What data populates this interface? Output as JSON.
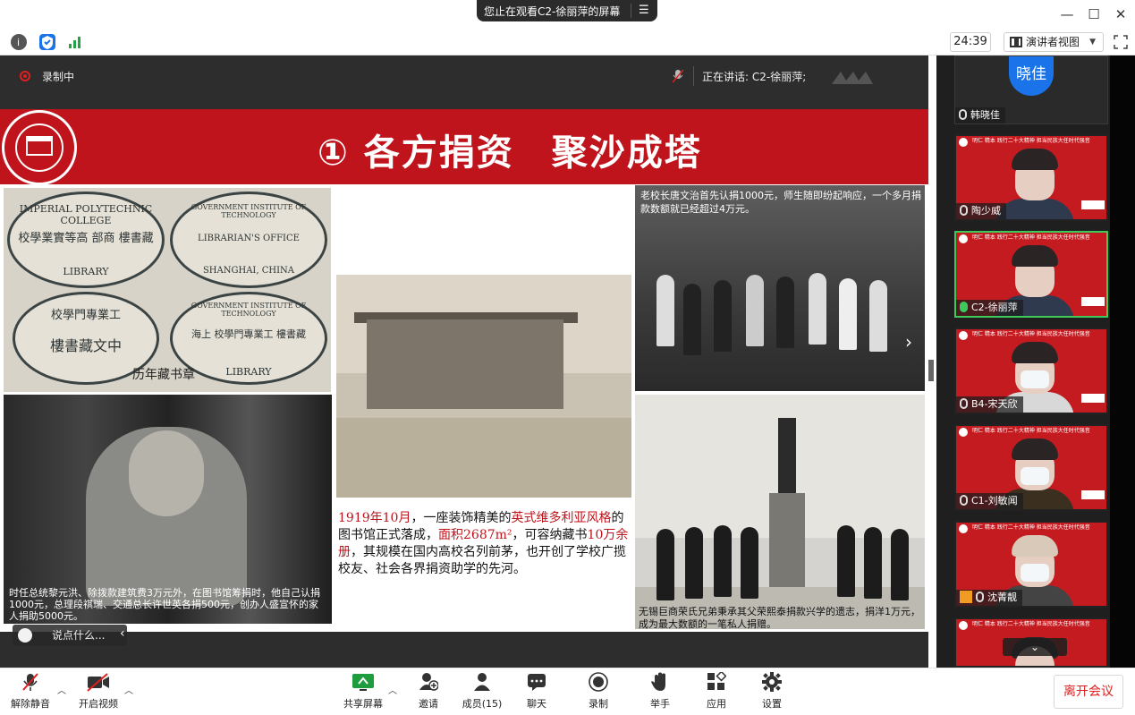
{
  "title_bar": {
    "viewing_label": "您止在观看C2-徐丽萍的屏幕",
    "menu_icon": "menu-icon",
    "window_controls": [
      "minimize-icon",
      "maximize-icon",
      "close-icon"
    ]
  },
  "top_toolbar": {
    "icons": [
      "info-icon",
      "shield-icon",
      "signal-bars-icon"
    ],
    "timer": "24:39",
    "presenter_view": "演讲者视图",
    "fullscreen_icon": "fullscreen-icon"
  },
  "share_header": {
    "recording_label": "录制中",
    "speaking_label": "正在讲话: C2-徐丽萍;"
  },
  "slide": {
    "title": "① 各方捐资　聚沙成塔",
    "stamps_caption": "历年藏书章",
    "stamp_texts": [
      "IMPERIAL POLYTECHNIC COLLEGE",
      "校學業實等高 部商 樓書藏",
      "LIBRARY",
      "GOVERNMENT INSTITUTE OF TECHNOLOGY",
      "LIBRARIAN'S OFFICE",
      "SHANGHAI, CHINA",
      "校學門專業工",
      "樓書藏文中",
      "海上 校學門專業工 樓書藏",
      "LIBRARY"
    ],
    "portrait_caption": "时任总统黎元洪、除拨款建筑费3万元外，在图书馆筹捐时，他自己认捐1000元，总理段祺瑞、交通总长许世英各捐500元，创办人盛宣怀的家人捐助5000元。",
    "library_text": {
      "p1": "1919年10月",
      "p2": "，一座装饰精美的",
      "p3": "英式维多利亚风格",
      "p4": "的图书馆正式落成，",
      "p5": "面积2687m²",
      "p6": "，可容纳藏书",
      "p7": "10万余册",
      "p8": "，其规模在国内高校名列前茅，也开创了学校广揽校友、社会各界捐资助学的先河。"
    },
    "group_text": "老校长唐文治首先认捐1000元，师生随即纷起响应，一个多月捐款数额就已经超过4万元。",
    "statue_text": "无锡巨商荣氏兄弟秉承其父荣熙泰捐款兴学的遗志，捐洋1万元，成为最大数额的一笔私人捐赠。"
  },
  "chat": {
    "placeholder": "说点什么..."
  },
  "participants": {
    "first": {
      "avatar": "晓佳",
      "name": "韩晓佳"
    },
    "tiles": [
      {
        "name": "陶少威",
        "banner": "明仁 精本 践行二十大精神 担当民族大任时代强音"
      },
      {
        "name": "C2-徐丽萍",
        "banner": "明仁 精本 践行二十大精神 担当民族大任时代强音"
      },
      {
        "name": "B4-宋天欣",
        "banner": "明仁 精本 践行二十大精神 担当民族大任时代强音"
      },
      {
        "name": "C1-刘敏闻",
        "banner": "明仁 精本 践行二十大精神 担当民族大任时代强音"
      },
      {
        "name": "沈菁靓",
        "banner": "明仁 精本 践行二十大精神 担当民族大任时代强音"
      },
      {
        "name": "",
        "banner": "明仁 精本 践行二十大精神 担当民族大任时代强音"
      }
    ]
  },
  "controls": {
    "unmute": "解除静音",
    "start_video": "开启视频",
    "share_screen": "共享屏幕",
    "invite": "邀请",
    "members": "成员(15)",
    "chat": "聊天",
    "record": "录制",
    "raise_hand": "举手",
    "apps": "应用",
    "settings": "设置",
    "leave": "离开会议"
  },
  "colors": {
    "slide_red": "#c0141c",
    "accent_green": "#3ec95a",
    "record_red": "#e02020",
    "avatar_blue": "#1a73e8"
  }
}
